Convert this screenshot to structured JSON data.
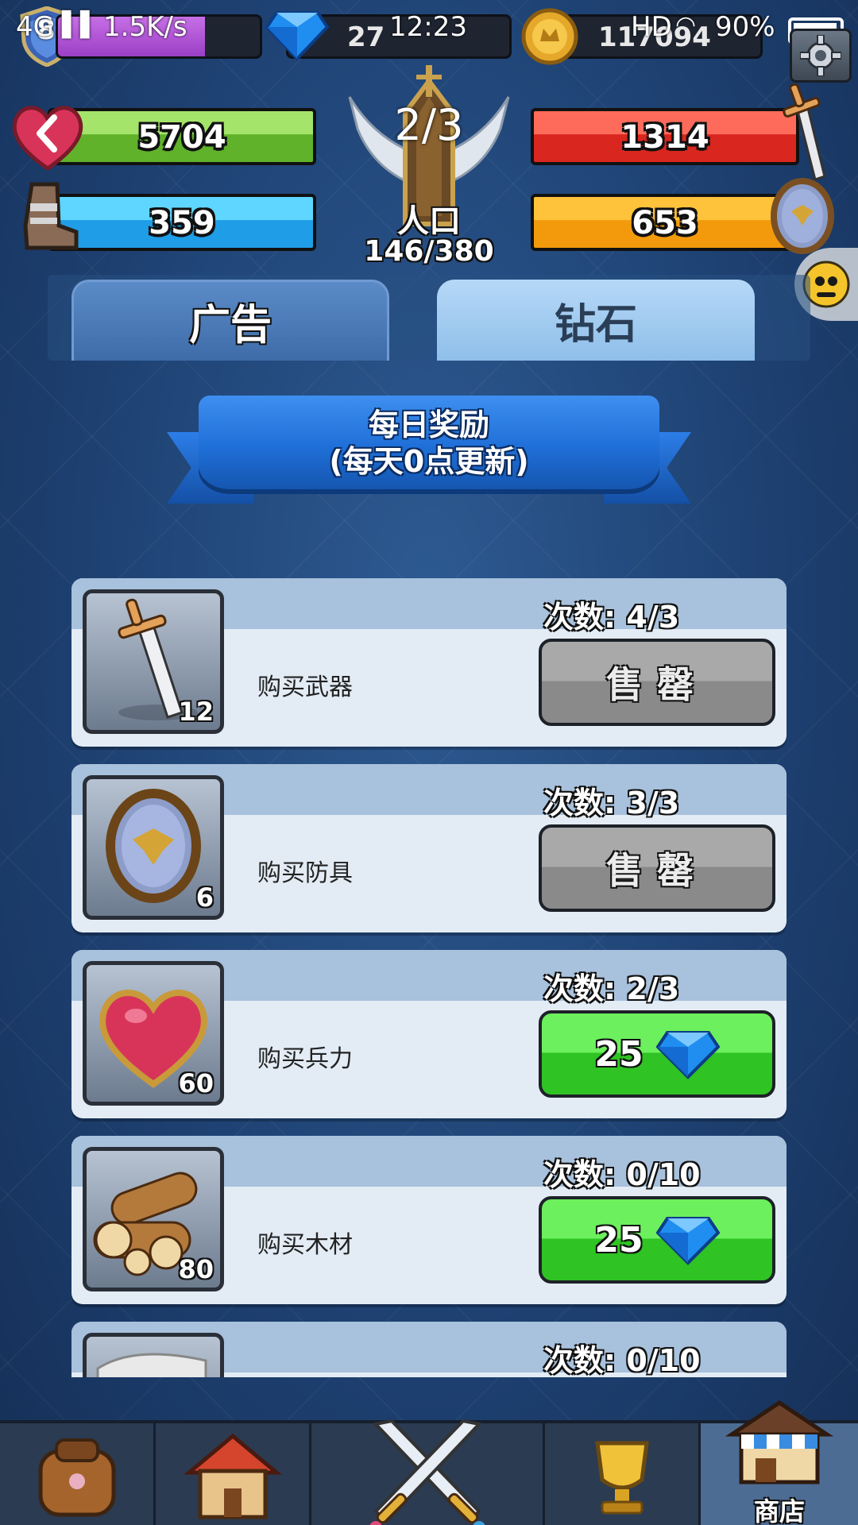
{
  "status_bar": {
    "network": "4G",
    "speed": "1.5K/s",
    "time": "12:23",
    "hd": "HD",
    "battery": "90%"
  },
  "resources": {
    "level_badge": "8",
    "gems": "27",
    "gold": "117094"
  },
  "stats": {
    "troops": "5704",
    "armor": "359",
    "attack": "1314",
    "defense": "653"
  },
  "center": {
    "stage": "2/3",
    "population_label": "人口",
    "population_value": "146/380"
  },
  "tabs": [
    {
      "label": "广告",
      "active": false
    },
    {
      "label": "钻石",
      "active": true
    }
  ],
  "banner": {
    "line1": "每日奖励",
    "line2": "(每天0点更新)"
  },
  "shop_items": [
    {
      "name": "购买武器",
      "qty": "12",
      "count": "次数: 4/3",
      "state": "sold",
      "button_label": "售罄",
      "icon": "sword-icon"
    },
    {
      "name": "购买防具",
      "qty": "6",
      "count": "次数: 3/3",
      "state": "sold",
      "button_label": "售罄",
      "icon": "shield-icon"
    },
    {
      "name": "购买兵力",
      "qty": "60",
      "count": "次数: 2/3",
      "state": "buy",
      "price": "25",
      "icon": "heart-icon"
    },
    {
      "name": "购买木材",
      "qty": "80",
      "count": "次数: 0/10",
      "state": "buy",
      "price": "25",
      "icon": "wood-logs-icon"
    },
    {
      "name": "",
      "qty": "",
      "count": "次数: 0/10",
      "state": "hidden",
      "icon": "cloth-icon"
    }
  ],
  "nav": {
    "shop_label": "商店"
  },
  "colors": {
    "buy_green": "#2fc324",
    "sold_gray": "#8a8a8a",
    "gem_blue": "#1f8ef0"
  }
}
